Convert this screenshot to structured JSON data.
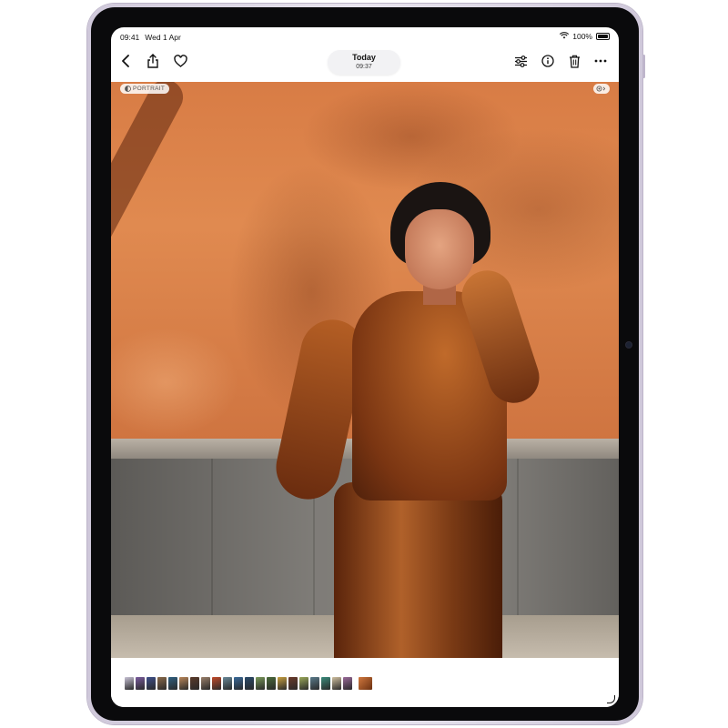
{
  "status_bar": {
    "time": "09:41",
    "date": "Wed 1 Apr",
    "battery": "100%"
  },
  "toolbar": {
    "title": "Today",
    "subtitle": "09:37"
  },
  "photo": {
    "portrait_badge": "PORTRAIT"
  },
  "filmstrip": {
    "thumbnail_colors": [
      "#c9c3d6",
      "#7a5c9e",
      "#3f4f8a",
      "#8a6a4a",
      "#2f5f7f",
      "#b8865a",
      "#5a3a2a",
      "#9a7f6a",
      "#c24a2a",
      "#6a8a9a",
      "#3a6a9a",
      "#2a4a6a",
      "#7a9a5a",
      "#4a6a3a",
      "#c8a040",
      "#6a3a2a",
      "#9aa85a",
      "#5a7a8a",
      "#3a8a7a",
      "#d0c0a0",
      "#9a6a9a"
    ]
  }
}
